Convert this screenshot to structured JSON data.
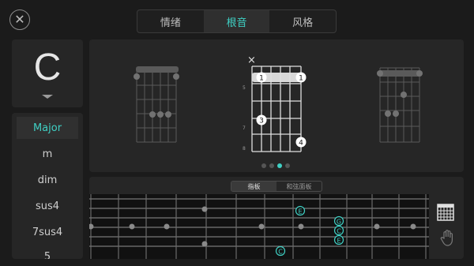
{
  "close_icon": "✕",
  "tabs": [
    {
      "label": "情绪",
      "active": false
    },
    {
      "label": "根音",
      "active": true
    },
    {
      "label": "风格",
      "active": false
    }
  ],
  "root": {
    "letter": "C"
  },
  "chord_types": [
    {
      "label": "Major",
      "active": true
    },
    {
      "label": "m",
      "active": false
    },
    {
      "label": "dim",
      "active": false
    },
    {
      "label": "sus4",
      "active": false
    },
    {
      "label": "7sus4",
      "active": false
    },
    {
      "label": "5",
      "active": false
    }
  ],
  "diagram": {
    "muted_mark": "×",
    "fret_numbers": [
      "5",
      "7",
      "8"
    ],
    "finger_labels": {
      "barre_left": "1",
      "barre_right": "1",
      "third": "3",
      "fourth": "4"
    },
    "page_dots": 4,
    "active_dot": 2
  },
  "fretboard": {
    "segments": [
      {
        "label": "指板",
        "active": true
      },
      {
        "label": "和弦面板",
        "active": false
      }
    ],
    "note_labels": [
      "E",
      "G",
      "C",
      "E",
      "C"
    ]
  },
  "icons": {
    "grid": "grid-icon",
    "hand": "hand-icon"
  },
  "colors": {
    "accent": "#3fd0c4",
    "bg": "#1b1b1b",
    "panel": "#262626"
  }
}
